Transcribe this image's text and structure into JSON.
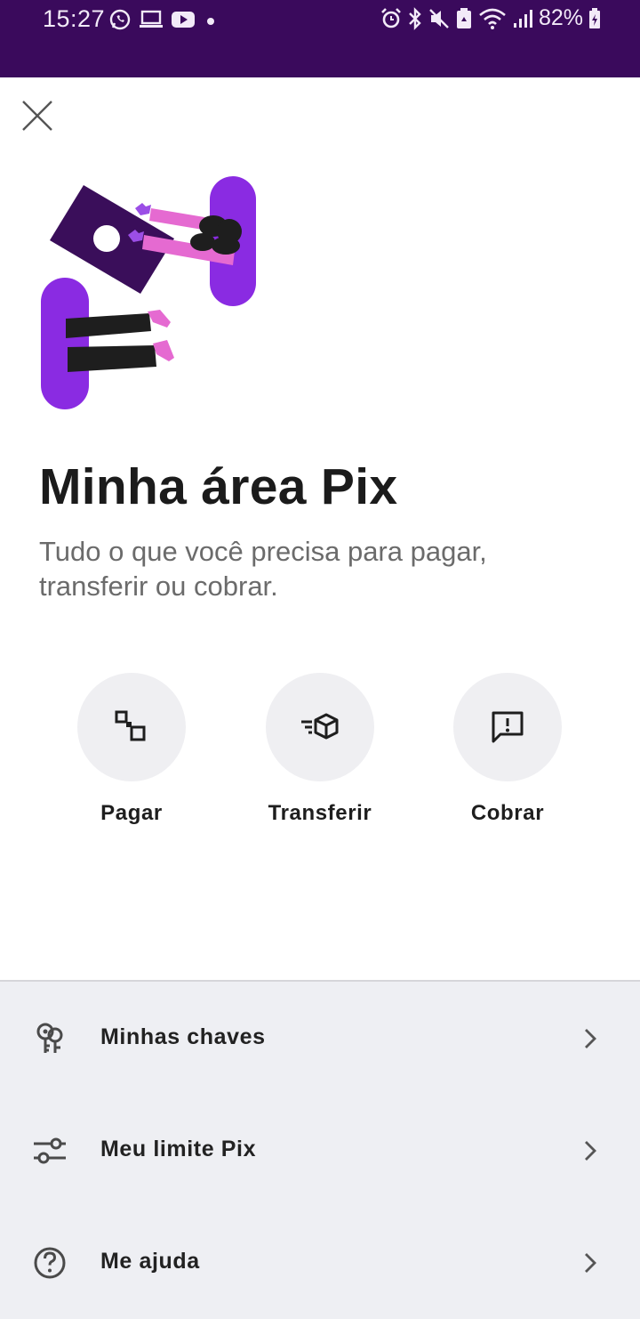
{
  "status_bar": {
    "time": "15:27",
    "battery_percent": "82%",
    "left_icons": [
      "whatsapp-icon",
      "laptop-icon",
      "youtube-icon",
      "dot-icon"
    ],
    "right_icons": [
      "alarm-icon",
      "bluetooth-icon",
      "mute-icon",
      "recycle-icon",
      "wifi-icon",
      "signal-icon",
      "battery-icon"
    ]
  },
  "header": {
    "close_icon": "close-icon",
    "title": "Minha área Pix",
    "subtitle": "Tudo o que você precisa para pagar, transferir ou cobrar."
  },
  "actions": [
    {
      "label": "Pagar",
      "icon": "qr-scan-icon"
    },
    {
      "label": "Transferir",
      "icon": "send-cube-icon"
    },
    {
      "label": "Cobrar",
      "icon": "message-alert-icon"
    }
  ],
  "menu": [
    {
      "label": "Minhas chaves",
      "icon": "keys-icon"
    },
    {
      "label": "Meu limite Pix",
      "icon": "sliders-icon"
    },
    {
      "label": "Me ajuda",
      "icon": "help-icon"
    }
  ],
  "colors": {
    "status_bar_bg": "#3a0a5c",
    "brand_purple": "#8a2be2",
    "illustration_pink": "#e56ad1",
    "panel_bg": "#eeeff3",
    "action_circle_bg": "#efeff2"
  }
}
